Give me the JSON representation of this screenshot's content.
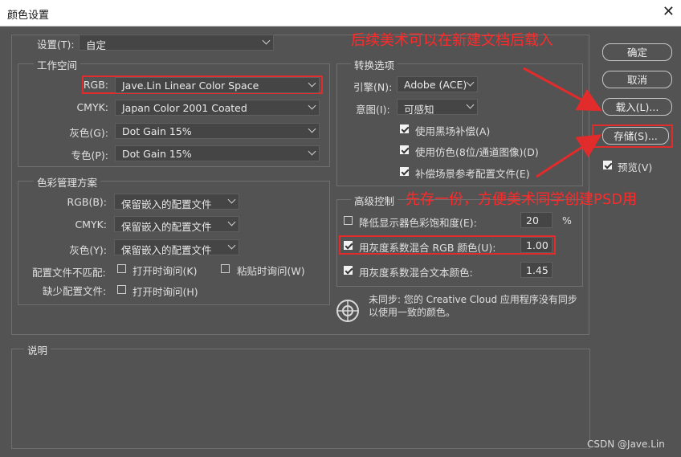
{
  "window": {
    "title": "颜色设置",
    "close_glyph": "✕"
  },
  "settings": {
    "label": "设置(T):",
    "value": "自定"
  },
  "workspace": {
    "title": "工作空间",
    "rows": [
      {
        "label": "RGB:",
        "value": "Jave.Lin Linear Color Space"
      },
      {
        "label": "CMYK:",
        "value": "Japan Color 2001 Coated"
      },
      {
        "label": "灰色(G):",
        "value": "Dot Gain 15%"
      },
      {
        "label": "专色(P):",
        "value": "Dot Gain 15%"
      }
    ]
  },
  "policies": {
    "title": "色彩管理方案",
    "rows": [
      {
        "label": "RGB(B):",
        "value": "保留嵌入的配置文件"
      },
      {
        "label": "CMYK:",
        "value": "保留嵌入的配置文件"
      },
      {
        "label": "灰色(Y):",
        "value": "保留嵌入的配置文件"
      }
    ],
    "mismatch_label": "配置文件不匹配:",
    "missing_label": "缺少配置文件:",
    "ask_open": "打开时询问(K)",
    "ask_paste": "粘贴时询问(W)",
    "ask_open_missing": "打开时询问(H)"
  },
  "conversion": {
    "title": "转换选项",
    "engine_label": "引擎(N):",
    "engine_value": "Adobe (ACE)",
    "intent_label": "意图(I):",
    "intent_value": "可感知",
    "checks": [
      {
        "label": "使用黑场补偿(A)",
        "checked": true
      },
      {
        "label": "使用仿色(8位/通道图像)(D)",
        "checked": true
      },
      {
        "label": "补偿场景参考配置文件(E)",
        "checked": true
      }
    ]
  },
  "advanced": {
    "title": "高级控制",
    "rows": [
      {
        "label": "降低显示器色彩饱和度(E):",
        "checked": false,
        "value": "20",
        "unit": "%"
      },
      {
        "label": "用灰度系数混合 RGB 颜色(U):",
        "checked": true,
        "value": "1.00"
      },
      {
        "label": "用灰度系数混合文本颜色:",
        "checked": true,
        "value": "1.45"
      }
    ]
  },
  "sync_text": "未同步: 您的 Creative Cloud 应用程序没有同步以使用一致的颜色。",
  "description": {
    "title": "说明"
  },
  "buttons": {
    "ok": "确定",
    "cancel": "取消",
    "load": "载入(L)...",
    "save": "存储(S)...",
    "preview": "预览(V)",
    "preview_checked": true
  },
  "annotations": {
    "top": "后续美术可以在新建文档后载入",
    "middle": "先存一份，方便美术同学创建PSD用",
    "color": "#e22b2b"
  },
  "watermark": "CSDN @Jave.Lin"
}
